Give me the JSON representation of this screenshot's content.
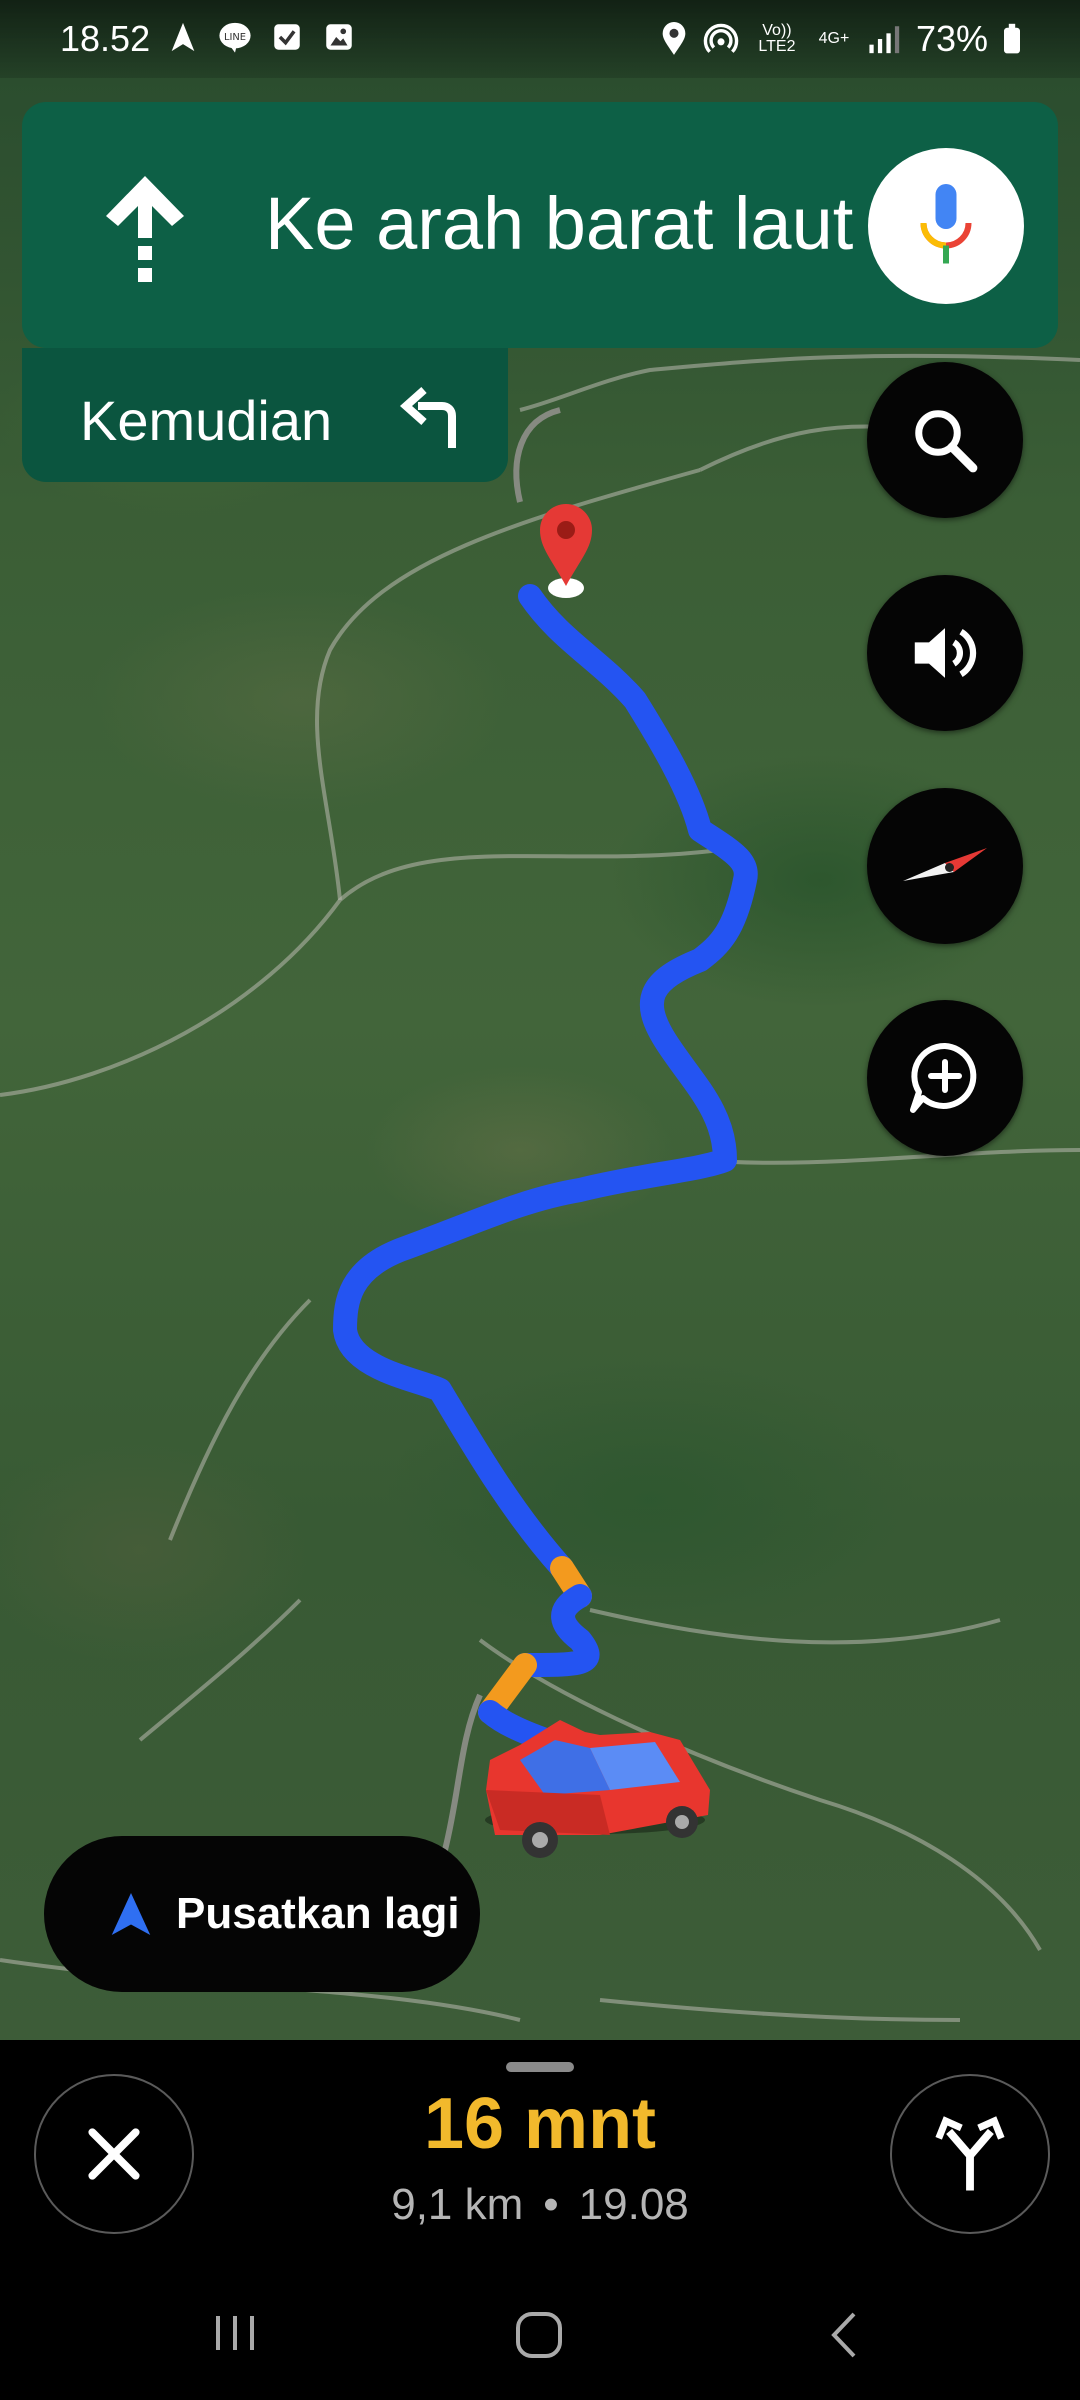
{
  "status_bar": {
    "time": "18.52",
    "volte": "Vo)) LTE2",
    "network": "4G+",
    "battery": "73%"
  },
  "navigation": {
    "instruction": "Ke arah barat laut",
    "then_label": "Kemudian",
    "direction_icon": "arrow-up-icon",
    "then_icon": "turn-left-icon"
  },
  "recenter": {
    "label": "Pusatkan lagi"
  },
  "trip": {
    "eta": "16 mnt",
    "distance": "9,1 km",
    "separator": "•",
    "arrival": "19.08"
  },
  "colors": {
    "header_green": "#0d6046",
    "route_blue": "#2454f2",
    "traffic_orange": "#f39a1e",
    "eta_yellow": "#f2b92c"
  }
}
